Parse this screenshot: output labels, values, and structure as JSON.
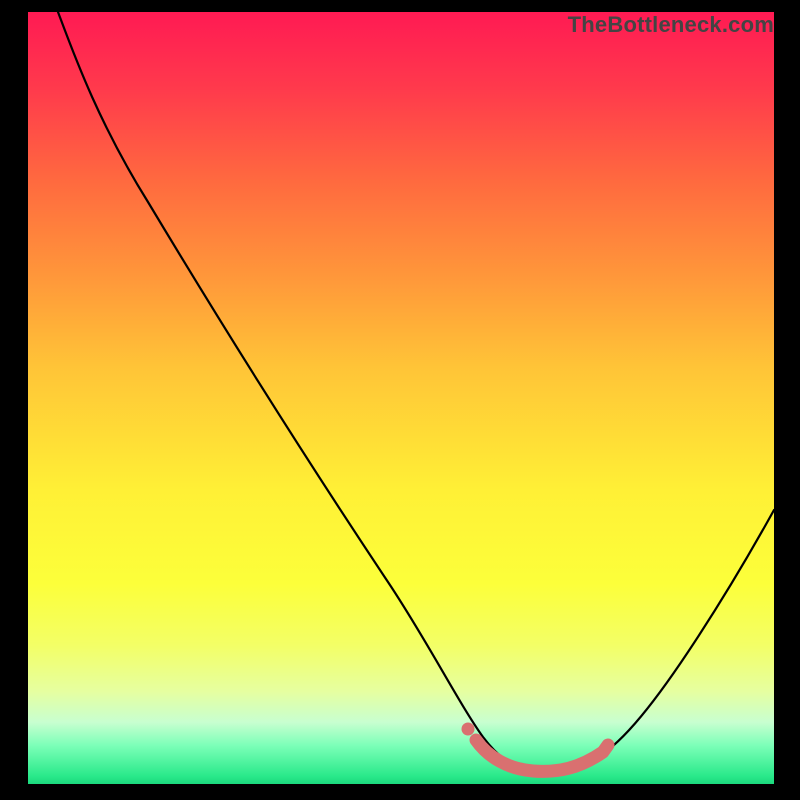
{
  "watermark": "TheBottleneck.com",
  "chart_data": {
    "type": "line",
    "title": "",
    "xlabel": "",
    "ylabel": "",
    "ylim": [
      0,
      100
    ],
    "xlim": [
      0,
      100
    ],
    "series": [
      {
        "name": "main-curve",
        "x": [
          4,
          8,
          15,
          25,
          35,
          45,
          55,
          58,
          62,
          66,
          70,
          74,
          78,
          82,
          86,
          90,
          94,
          98
        ],
        "values": [
          100,
          93,
          81,
          65,
          49,
          33,
          16,
          10,
          5,
          2,
          1,
          1,
          2,
          6,
          12,
          19,
          27,
          36
        ]
      },
      {
        "name": "threshold-highlight",
        "x": [
          60,
          63,
          66,
          70,
          73,
          76,
          78
        ],
        "values": [
          4,
          2,
          1,
          1,
          1,
          2,
          4
        ]
      }
    ],
    "colors": {
      "curve": "#000000",
      "highlight": "#d97070",
      "gradient_top": "#ff1a53",
      "gradient_mid": "#fff036",
      "gradient_bottom": "#1bd87d"
    }
  }
}
